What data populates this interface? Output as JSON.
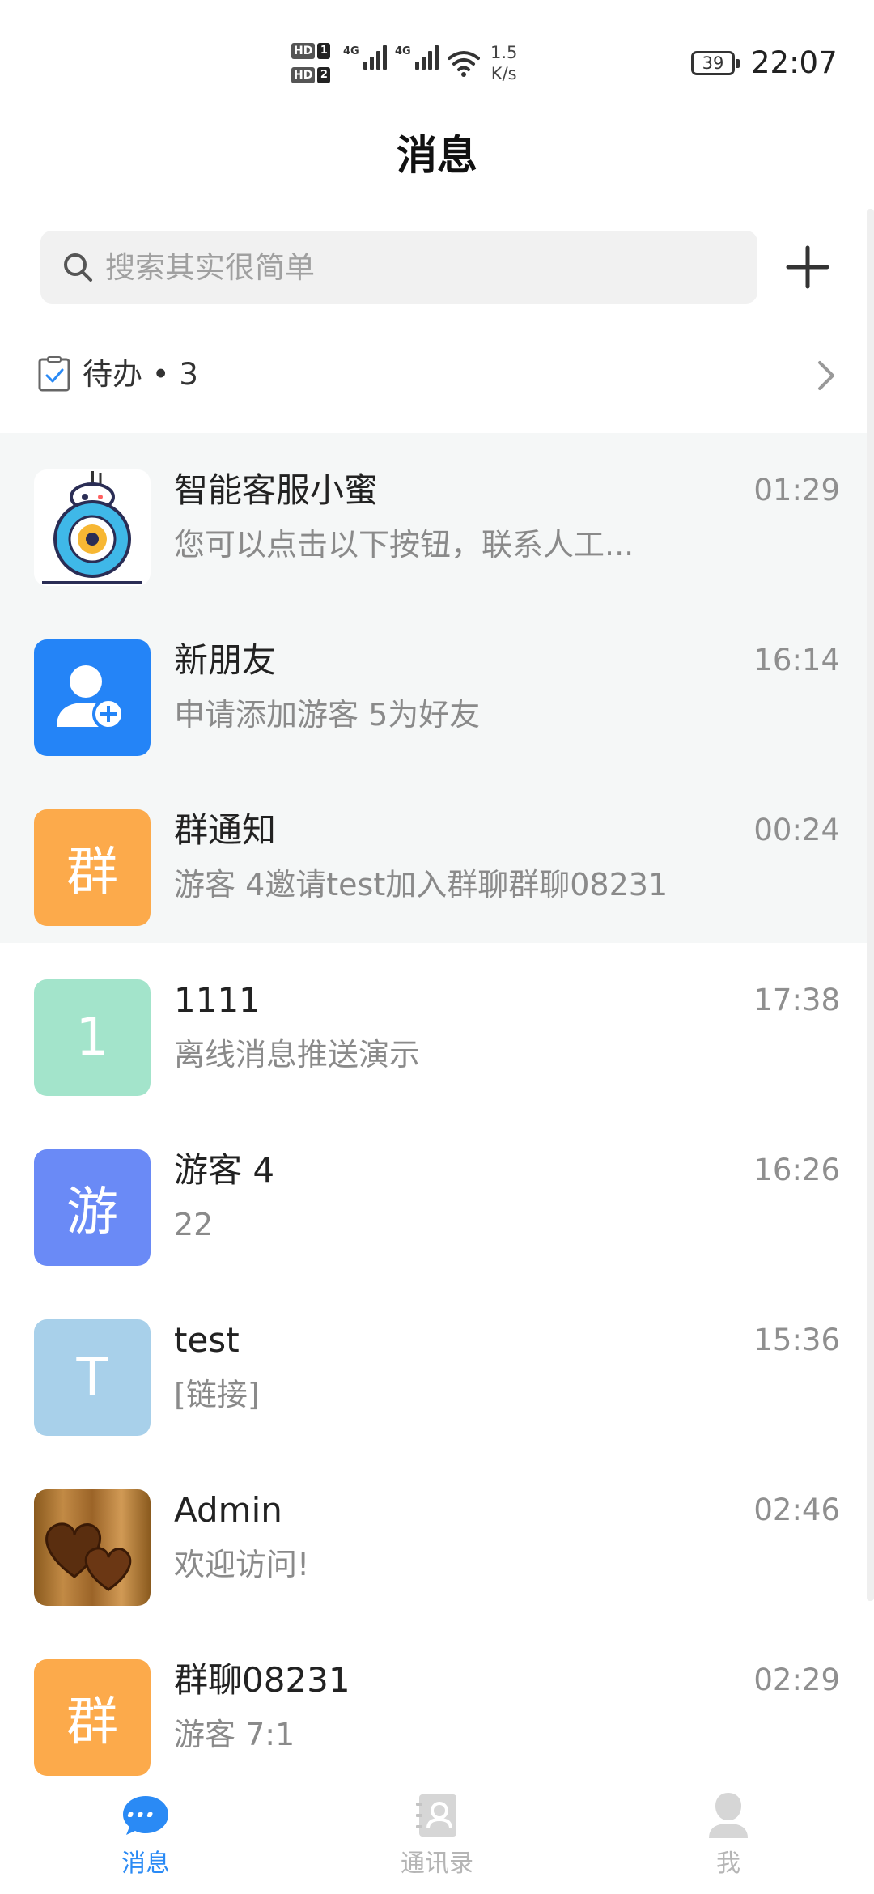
{
  "status_bar": {
    "hd_label": "HD",
    "sim1": "1",
    "sim2": "2",
    "network1": "4G",
    "network2": "4G",
    "speed_value": "1.5",
    "speed_unit": "K/s",
    "battery": "39",
    "time": "22:07"
  },
  "header": {
    "title": "消息",
    "search_placeholder": "搜索其实很简单"
  },
  "todo": {
    "label": "待办 • 3"
  },
  "conversations": [
    {
      "name": "智能客服小蜜",
      "message": "您可以点击以下按钮，联系人工...",
      "time": "01:29",
      "avatar_text": "",
      "avatar_icon": "robot-icon",
      "pinned": true
    },
    {
      "name": "新朋友",
      "message": "申请添加游客 5为好友",
      "time": "16:14",
      "avatar_text": "",
      "avatar_icon": "add-friend-icon",
      "avatar_color": "#2484f7",
      "pinned": true
    },
    {
      "name": "群通知",
      "message": "游客 4邀请test加入群聊群聊08231",
      "time": "00:24",
      "avatar_text": "群",
      "avatar_color": "#fcaa4b",
      "pinned": true
    },
    {
      "name": "1111",
      "message": "离线消息推送演示",
      "time": "17:38",
      "avatar_text": "1",
      "avatar_color": "#a3e4cb",
      "pinned": false
    },
    {
      "name": "游客 4",
      "message": "22",
      "time": "16:26",
      "avatar_text": "游",
      "avatar_color": "#6a8af6",
      "pinned": false
    },
    {
      "name": "test",
      "message": "[链接]",
      "time": "15:36",
      "avatar_text": "T",
      "avatar_color": "#a8d0ea",
      "pinned": false
    },
    {
      "name": "Admin",
      "message": "欢迎访问!",
      "time": "02:46",
      "avatar_text": "",
      "avatar_icon": "hearts-wood-image",
      "pinned": false
    },
    {
      "name": "群聊08231",
      "message": "游客 7:1",
      "time": "02:29",
      "avatar_text": "群",
      "avatar_color": "#fcaa4b",
      "pinned": false
    }
  ],
  "tabs": [
    {
      "label": "消息",
      "icon": "chat-bubble-icon",
      "active": true
    },
    {
      "label": "通讯录",
      "icon": "contacts-icon",
      "active": false
    },
    {
      "label": "我",
      "icon": "profile-icon",
      "active": false
    }
  ],
  "colors": {
    "accent": "#2a8af5",
    "inactive_tab": "#b5b5b5",
    "pinned_background": "#f5f7f7"
  }
}
